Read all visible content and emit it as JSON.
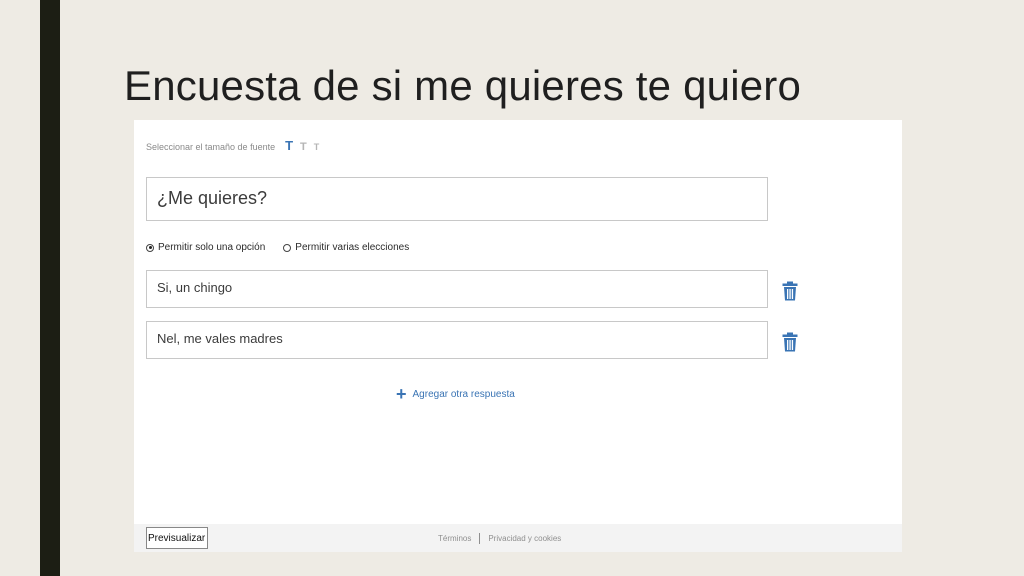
{
  "slide": {
    "title": "Encuesta de si me quieres te quiero"
  },
  "form": {
    "font_size_label": "Seleccionar el tamaño de fuente",
    "font_size_options": [
      "T",
      "T",
      "T"
    ],
    "question": "¿Me quieres?",
    "radio_options": [
      {
        "label": "Permitir solo una opción",
        "checked": true
      },
      {
        "label": "Permitir varias elecciones",
        "checked": false
      }
    ],
    "answers": [
      {
        "text": "Si, un chingo"
      },
      {
        "text": "Nel, me vales madres"
      }
    ],
    "add_answer_label": "Agregar otra respuesta",
    "accent_color": "#3a74b4"
  },
  "footer": {
    "preview_label": "Previsualizar",
    "terms_label": "Términos",
    "privacy_label": "Privacidad y cookies"
  },
  "icons": {
    "trash": "trash-icon",
    "plus": "plus-icon"
  }
}
